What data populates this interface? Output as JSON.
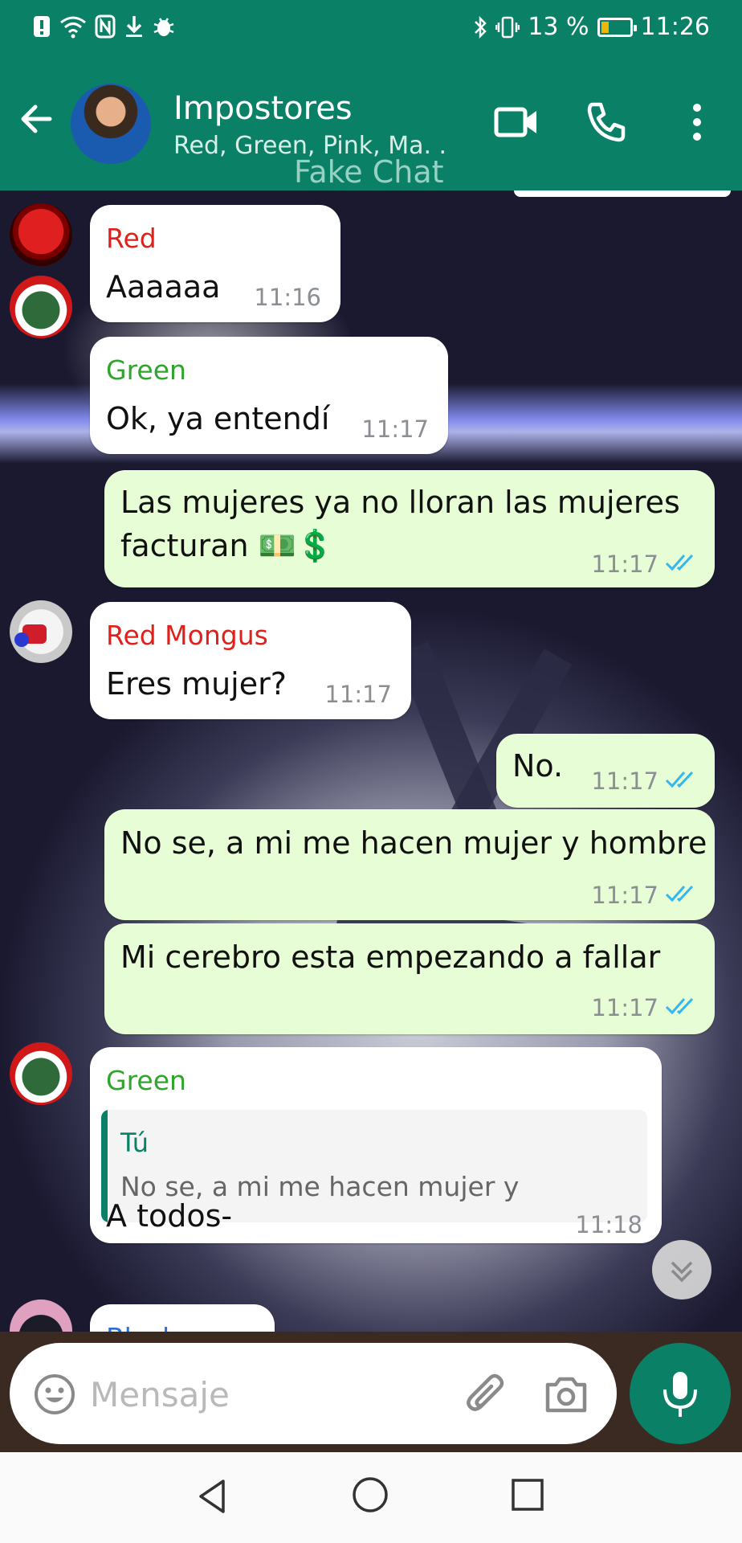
{
  "status_bar": {
    "left_icons": [
      "alert-icon",
      "wifi-icon",
      "nfc-icon",
      "download-icon",
      "bug-icon"
    ],
    "battery_text": "13 %",
    "time": "11:26",
    "battery_level": 0.13
  },
  "header": {
    "title": "Impostores",
    "subtitle": "Red, Green, Pink, Ma. .",
    "watermark": "Fake Chat"
  },
  "messages": [
    {
      "direction": "in",
      "sender": "Red",
      "sender_color": "#e0201a",
      "text": "Aaaaaa",
      "time": "11:16"
    },
    {
      "direction": "in",
      "sender": "Green",
      "sender_color": "#2fa52d",
      "text": "Ok, ya entendí",
      "time": "11:17"
    },
    {
      "direction": "out",
      "text_line1": "Las mujeres ya no lloran las mujeres",
      "text_line2": "facturan 💵💲",
      "time": "11:17",
      "status": "read"
    },
    {
      "direction": "in",
      "sender": "Red Mongus",
      "sender_color": "#e0201a",
      "text": "Eres mujer?",
      "time": "11:17"
    },
    {
      "direction": "out",
      "text": "No.",
      "time": "11:17",
      "status": "read"
    },
    {
      "direction": "out",
      "text": "No se, a mi me hacen mujer y hombre",
      "time": "11:17",
      "status": "read"
    },
    {
      "direction": "out",
      "text": "Mi cerebro esta empezando a fallar",
      "time": "11:17",
      "status": "read"
    },
    {
      "direction": "in",
      "sender": "Green",
      "sender_color": "#2fa52d",
      "reply": {
        "author": "Tú",
        "text": "No se, a mi me hacen mujer y"
      },
      "text": "A todos-",
      "time": "11:18"
    },
    {
      "direction": "in",
      "sender": "Black",
      "sender_color": "#2b6fd6"
    }
  ],
  "input": {
    "placeholder": "Mensaje"
  },
  "colors": {
    "header": "#0a8066",
    "outgoing_bubble": "#e7fdd6",
    "incoming_bubble": "#ffffff",
    "read_ticks": "#34b7f1"
  }
}
